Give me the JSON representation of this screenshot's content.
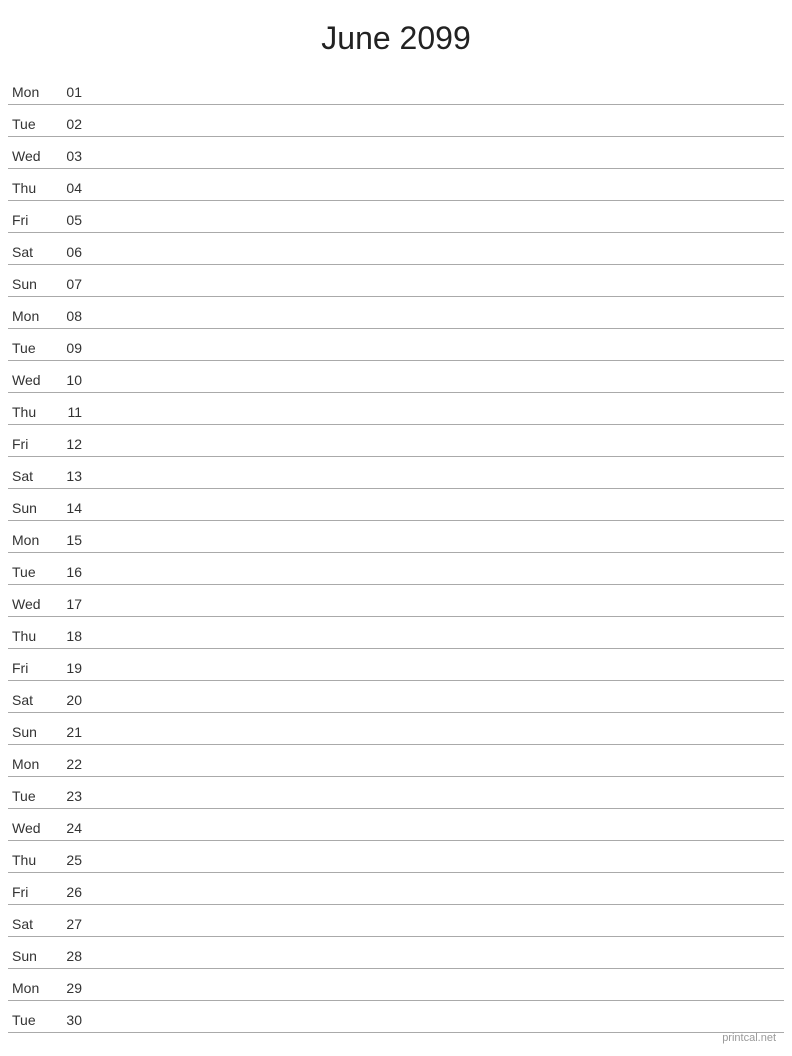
{
  "title": "June 2099",
  "watermark": "printcal.net",
  "days": [
    {
      "name": "Mon",
      "number": "01"
    },
    {
      "name": "Tue",
      "number": "02"
    },
    {
      "name": "Wed",
      "number": "03"
    },
    {
      "name": "Thu",
      "number": "04"
    },
    {
      "name": "Fri",
      "number": "05"
    },
    {
      "name": "Sat",
      "number": "06"
    },
    {
      "name": "Sun",
      "number": "07"
    },
    {
      "name": "Mon",
      "number": "08"
    },
    {
      "name": "Tue",
      "number": "09"
    },
    {
      "name": "Wed",
      "number": "10"
    },
    {
      "name": "Thu",
      "number": "11"
    },
    {
      "name": "Fri",
      "number": "12"
    },
    {
      "name": "Sat",
      "number": "13"
    },
    {
      "name": "Sun",
      "number": "14"
    },
    {
      "name": "Mon",
      "number": "15"
    },
    {
      "name": "Tue",
      "number": "16"
    },
    {
      "name": "Wed",
      "number": "17"
    },
    {
      "name": "Thu",
      "number": "18"
    },
    {
      "name": "Fri",
      "number": "19"
    },
    {
      "name": "Sat",
      "number": "20"
    },
    {
      "name": "Sun",
      "number": "21"
    },
    {
      "name": "Mon",
      "number": "22"
    },
    {
      "name": "Tue",
      "number": "23"
    },
    {
      "name": "Wed",
      "number": "24"
    },
    {
      "name": "Thu",
      "number": "25"
    },
    {
      "name": "Fri",
      "number": "26"
    },
    {
      "name": "Sat",
      "number": "27"
    },
    {
      "name": "Sun",
      "number": "28"
    },
    {
      "name": "Mon",
      "number": "29"
    },
    {
      "name": "Tue",
      "number": "30"
    }
  ]
}
